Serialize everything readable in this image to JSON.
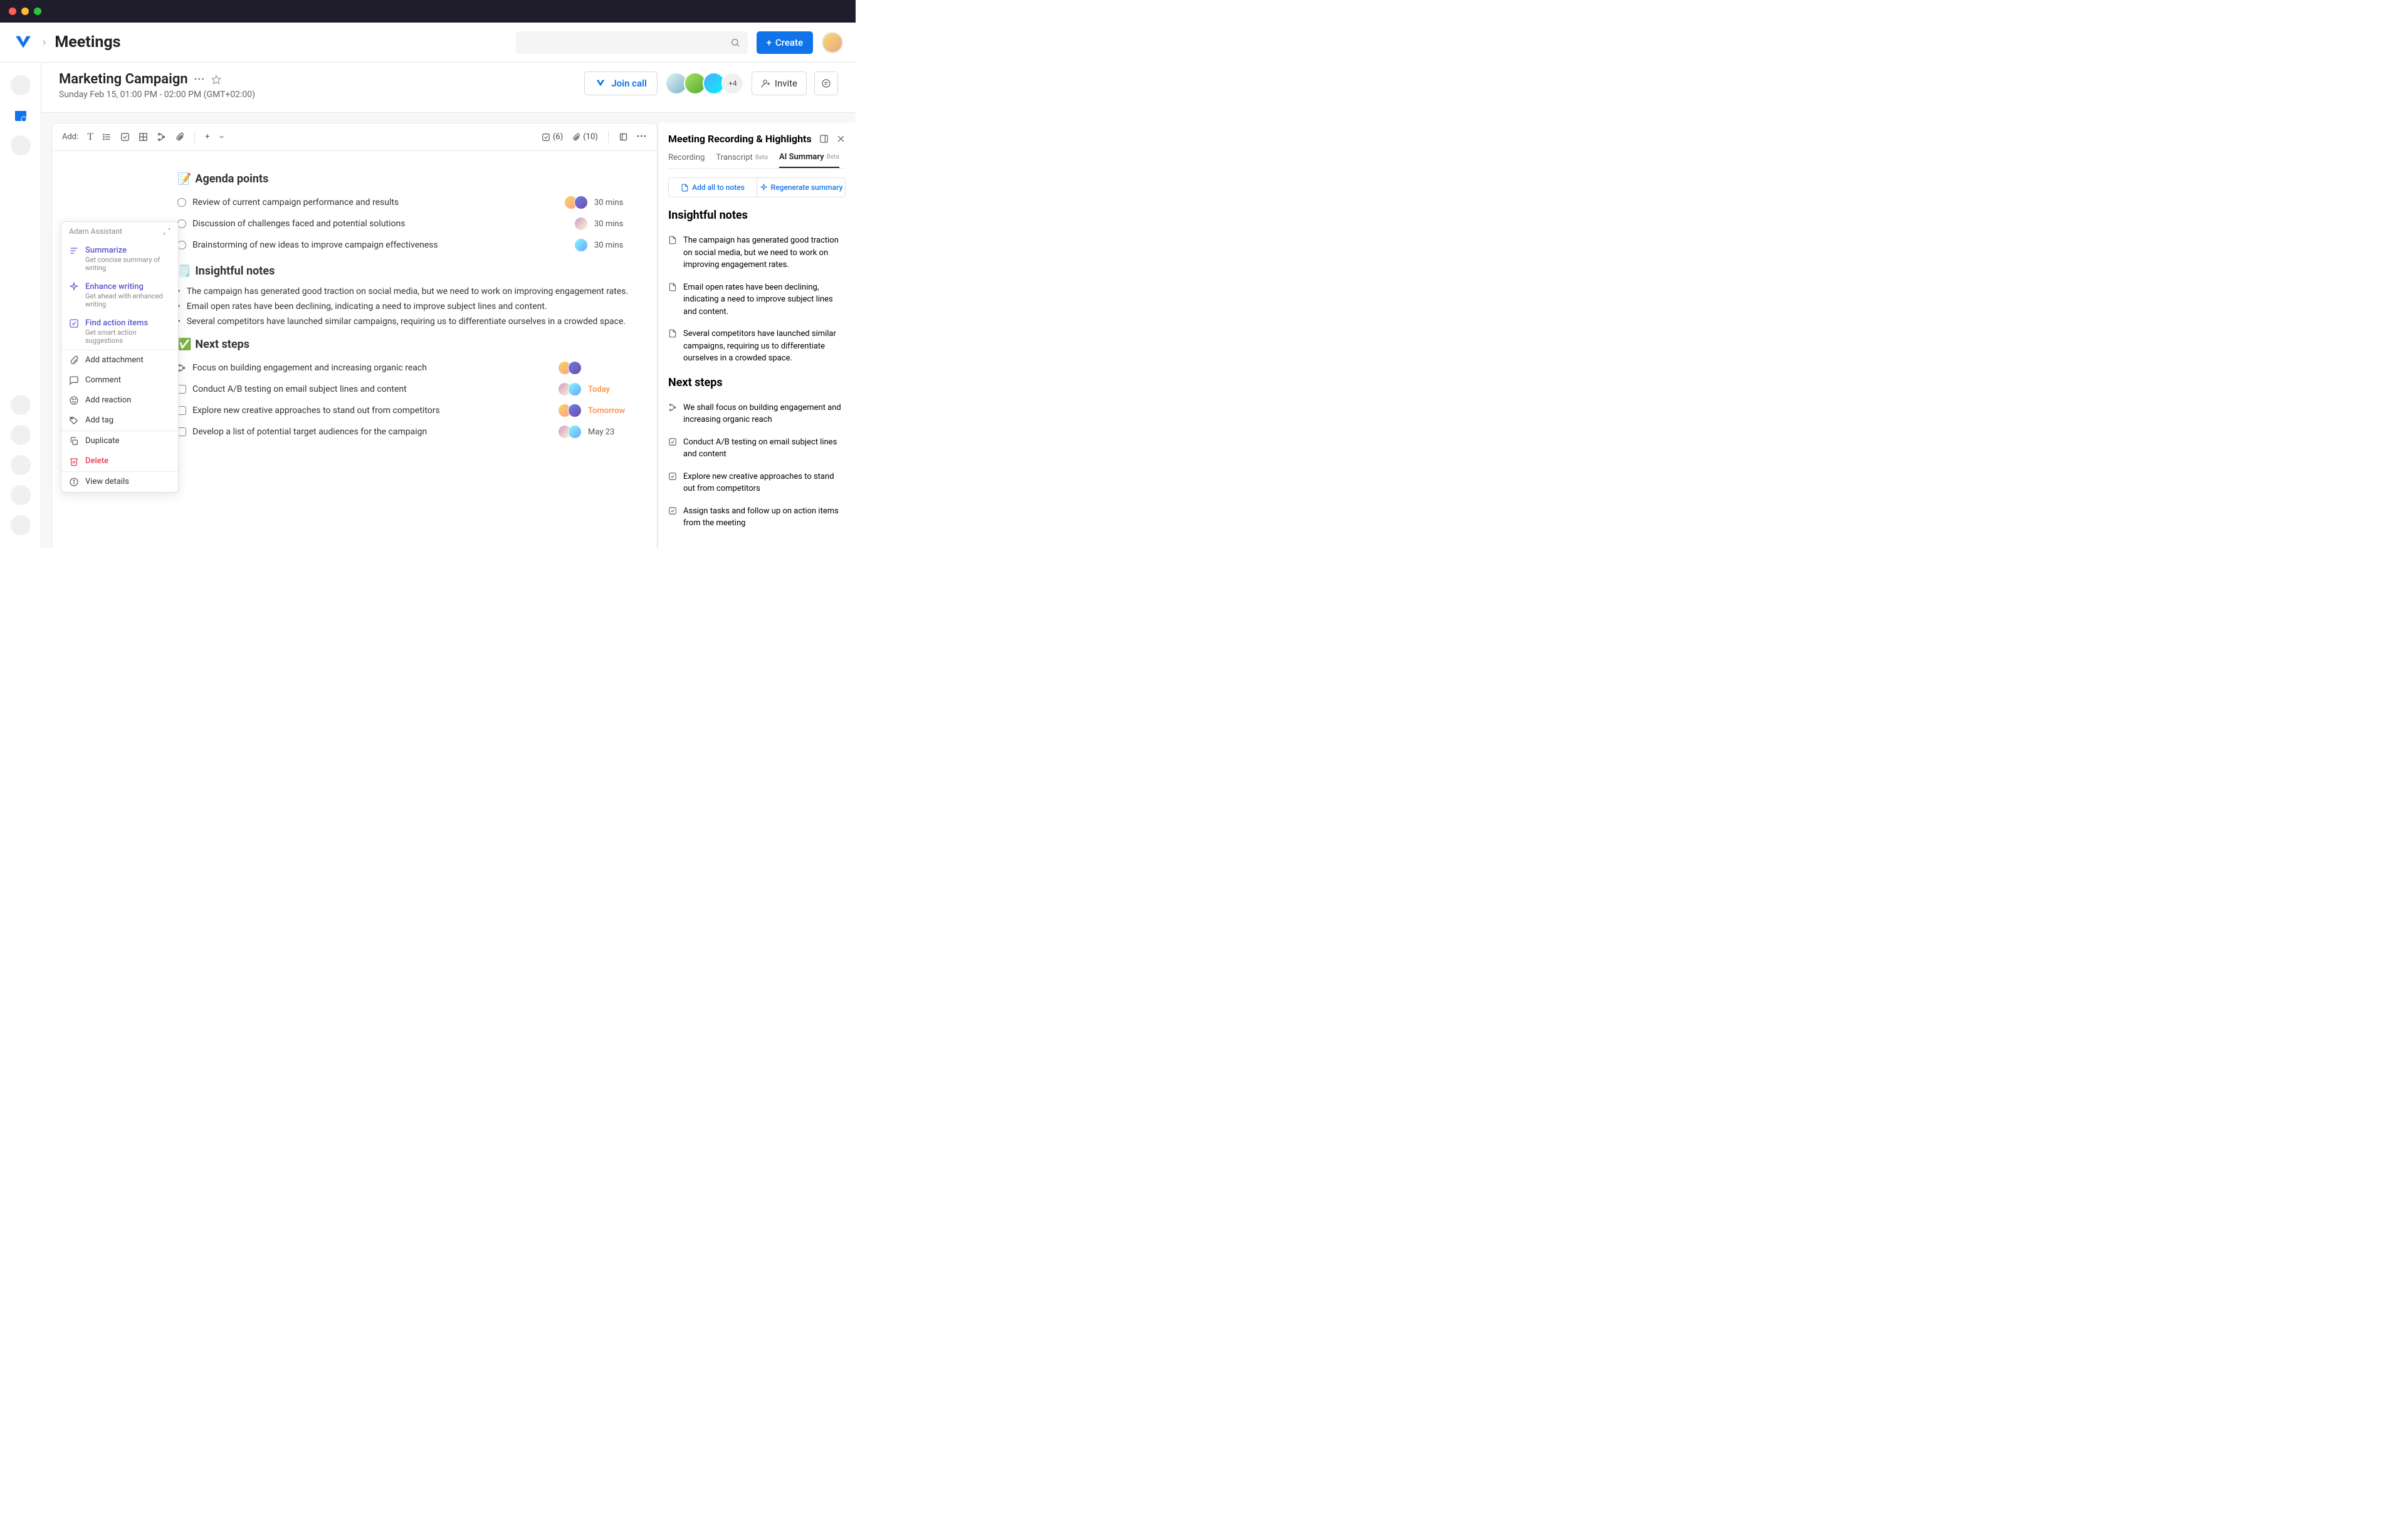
{
  "header": {
    "pageTitle": "Meetings",
    "createLabel": "Create"
  },
  "meeting": {
    "title": "Marketing Campaign",
    "time": "Sunday Feb 15, 01:00 PM - 02:00 PM (GMT+02:00)",
    "joinLabel": "Join call",
    "inviteLabel": "Invite",
    "attendeeMore": "+4"
  },
  "toolbar": {
    "addLabel": "Add:",
    "checkCount": "(6)",
    "attachCount": "(10)"
  },
  "doc": {
    "agendaTitle": "Agenda points",
    "agenda": [
      {
        "text": "Review of current campaign performance and results",
        "duration": "30 mins"
      },
      {
        "text": "Discussion of challenges faced and potential solutions",
        "duration": "30 mins"
      },
      {
        "text": "Brainstorming of new ideas to improve campaign effectiveness",
        "duration": "30 mins"
      }
    ],
    "notesTitle": "Insightful notes",
    "notes": [
      "The campaign has generated good traction on social media, but we need to work on improving engagement rates.",
      "Email open rates have been declining, indicating a need to improve subject lines and content.",
      "Several competitors have launched similar campaigns, requiring us to differentiate ourselves in a crowded space."
    ],
    "stepsTitle": "Next steps",
    "steps": [
      {
        "text": "Focus on building engagement and increasing organic reach",
        "due": "",
        "type": "branch"
      },
      {
        "text": "Conduct A/B testing on email subject lines and content",
        "due": "Today",
        "orange": true,
        "type": "check"
      },
      {
        "text": "Explore new creative approaches to stand out from competitors",
        "due": "Tomorrow",
        "orange": true,
        "type": "check"
      },
      {
        "text": "Develop a list of potential target audiences for the campaign",
        "due": "May 23",
        "type": "check"
      }
    ]
  },
  "contextMenu": {
    "header": "Adam Assistant",
    "ai": [
      {
        "title": "Summarize",
        "sub": "Get concise summary of writing"
      },
      {
        "title": "Enhance writing",
        "sub": "Get ahead with enhanced writing"
      },
      {
        "title": "Find action items",
        "sub": "Get smart action suggestions"
      }
    ],
    "actions": {
      "attach": "Add attachment",
      "comment": "Comment",
      "reaction": "Add reaction",
      "tag": "Add tag",
      "duplicate": "Duplicate",
      "delete": "Delete",
      "details": "View details"
    }
  },
  "sidePanel": {
    "title": "Meeting Recording & Highlights",
    "tabs": {
      "recording": "Recording",
      "transcript": "Transcript",
      "aisummary": "AI Summary",
      "beta": "Beta"
    },
    "actions": {
      "addAll": "Add all to notes",
      "regen": "Regenerate summary"
    },
    "notesHeading": "Insightful notes",
    "notes": [
      "The campaign has generated good traction on social media, but we need to work on improving engagement rates.",
      "Email open rates have been declining, indicating a need to improve subject lines and content.",
      "Several competitors have launched similar campaigns, requiring us to differentiate ourselves in a crowded space."
    ],
    "stepsHeading": "Next steps",
    "steps": [
      "We shall focus on building engagement and increasing organic reach",
      "Conduct A/B testing on email subject lines and content",
      "Explore new creative approaches to stand out from competitors",
      "Assign tasks and follow up on action items from the meeting"
    ]
  }
}
